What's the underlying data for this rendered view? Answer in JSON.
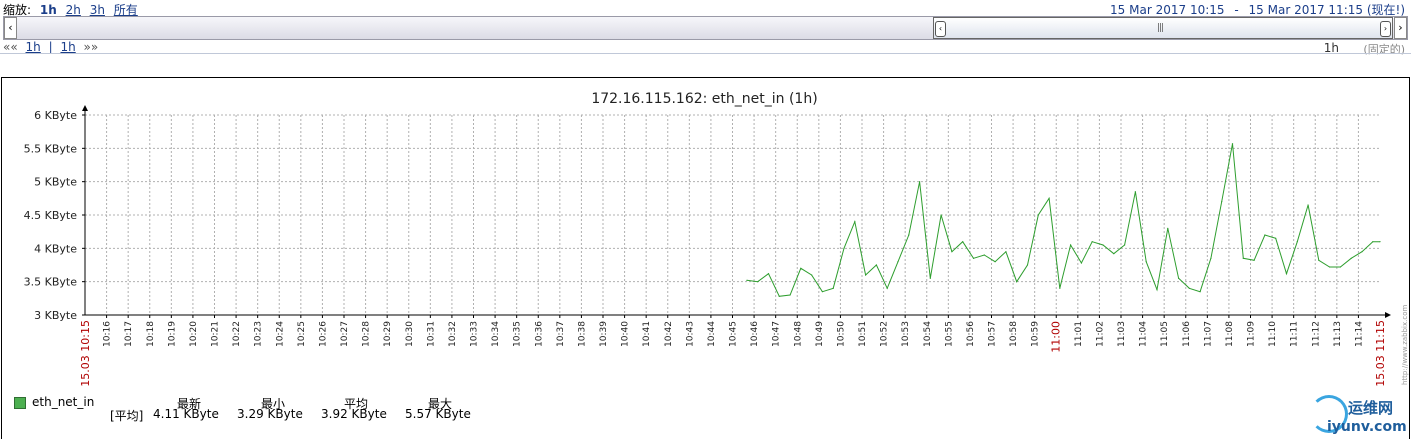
{
  "nav": {
    "zoom_label": "缩放:",
    "zoom_options": [
      "1h",
      "2h",
      "3h",
      "所有"
    ],
    "range_from": "15 Mar 2017 10:15",
    "range_sep": "-",
    "range_to": "15 Mar 2017 11:15 (现在!)",
    "back_arrows": "««",
    "back_link": "1h",
    "pipe": "|",
    "forward_link": "1h",
    "forward_arrows": "»»",
    "period": "1h",
    "fixed": "(固定的)",
    "left_arrow_glyph": "‹",
    "right_arrow_glyph": "›"
  },
  "chart_data": {
    "type": "line",
    "title": "172.16.115.162: eth_net_in (1h)",
    "y_unit": "KByte",
    "y_ticks": [
      "6 KByte",
      "5.5 KByte",
      "5 KByte",
      "4.5 KByte",
      "4 KByte",
      "3.5 KByte",
      "3 KByte"
    ],
    "ylim": [
      3,
      6
    ],
    "x_start_label": "15.03 10:15",
    "x_end_label": "15.03 11:15",
    "x_tick_labels": [
      "10:16",
      "10:17",
      "10:18",
      "10:19",
      "10:20",
      "10:21",
      "10:22",
      "10:23",
      "10:24",
      "10:25",
      "10:26",
      "10:27",
      "10:28",
      "10:29",
      "10:30",
      "10:31",
      "10:32",
      "10:33",
      "10:34",
      "10:35",
      "10:36",
      "10:37",
      "10:38",
      "10:39",
      "10:40",
      "10:41",
      "10:42",
      "10:43",
      "10:44",
      "10:45",
      "10:46",
      "10:47",
      "10:48",
      "10:49",
      "10:50",
      "10:51",
      "10:52",
      "10:53",
      "10:54",
      "10:55",
      "10:56",
      "10:57",
      "10:58",
      "10:59",
      "11:00",
      "11:01",
      "11:02",
      "11:03",
      "11:04",
      "11:05",
      "11:06",
      "11:07",
      "11:08",
      "11:09",
      "11:10",
      "11:11",
      "11:12",
      "11:13",
      "11:14"
    ],
    "highlight_tick": "11:00",
    "series": [
      {
        "name": "eth_net_in",
        "color": "#2e9e2e",
        "points": [
          [
            "10:45:40",
            3.52
          ],
          [
            "10:46:10",
            3.5
          ],
          [
            "10:46:40",
            3.62
          ],
          [
            "10:47:10",
            3.28
          ],
          [
            "10:47:40",
            3.3
          ],
          [
            "10:48:10",
            3.7
          ],
          [
            "10:48:40",
            3.6
          ],
          [
            "10:49:10",
            3.35
          ],
          [
            "10:49:40",
            3.4
          ],
          [
            "10:50:10",
            4.0
          ],
          [
            "10:50:40",
            4.4
          ],
          [
            "10:51:10",
            3.6
          ],
          [
            "10:51:40",
            3.75
          ],
          [
            "10:52:10",
            3.4
          ],
          [
            "10:52:40",
            3.8
          ],
          [
            "10:53:10",
            4.2
          ],
          [
            "10:53:40",
            5.0
          ],
          [
            "10:54:10",
            3.55
          ],
          [
            "10:54:40",
            4.5
          ],
          [
            "10:55:10",
            3.95
          ],
          [
            "10:55:40",
            4.1
          ],
          [
            "10:56:10",
            3.85
          ],
          [
            "10:56:40",
            3.9
          ],
          [
            "10:57:10",
            3.8
          ],
          [
            "10:57:40",
            3.95
          ],
          [
            "10:58:10",
            3.5
          ],
          [
            "10:58:40",
            3.75
          ],
          [
            "10:59:10",
            4.5
          ],
          [
            "10:59:40",
            4.75
          ],
          [
            "11:00:10",
            3.4
          ],
          [
            "11:00:40",
            4.05
          ],
          [
            "11:01:10",
            3.78
          ],
          [
            "11:01:40",
            4.1
          ],
          [
            "11:02:10",
            4.05
          ],
          [
            "11:02:40",
            3.92
          ],
          [
            "11:03:10",
            4.05
          ],
          [
            "11:03:40",
            4.85
          ],
          [
            "11:04:10",
            3.8
          ],
          [
            "11:04:40",
            3.38
          ],
          [
            "11:05:10",
            4.3
          ],
          [
            "11:05:40",
            3.55
          ],
          [
            "11:06:10",
            3.4
          ],
          [
            "11:06:40",
            3.35
          ],
          [
            "11:07:10",
            3.85
          ],
          [
            "11:07:40",
            4.7
          ],
          [
            "11:08:10",
            5.57
          ],
          [
            "11:08:40",
            3.85
          ],
          [
            "11:09:10",
            3.82
          ],
          [
            "11:09:40",
            4.2
          ],
          [
            "11:10:10",
            4.15
          ],
          [
            "11:10:40",
            3.62
          ],
          [
            "11:11:10",
            4.1
          ],
          [
            "11:11:40",
            4.65
          ],
          [
            "11:12:10",
            3.82
          ],
          [
            "11:12:40",
            3.72
          ],
          [
            "11:13:10",
            3.72
          ],
          [
            "11:13:40",
            3.85
          ],
          [
            "11:14:10",
            3.95
          ],
          [
            "11:14:40",
            4.1
          ],
          [
            "11:15:00",
            4.1
          ]
        ]
      }
    ],
    "legend": {
      "name": "eth_net_in",
      "func": "[平均]",
      "headers": [
        "最新",
        "最小",
        "平均",
        "最大"
      ],
      "values": [
        "4.11 KByte",
        "3.29 KByte",
        "3.92 KByte",
        "5.57 KByte"
      ],
      "swatch_color": "#4caf50"
    },
    "grid": true,
    "legend_position": "bottom-left"
  },
  "side_text": "http://www.zabbix.com",
  "watermark": {
    "cn": "运维网",
    "en": "iyunv.com"
  }
}
